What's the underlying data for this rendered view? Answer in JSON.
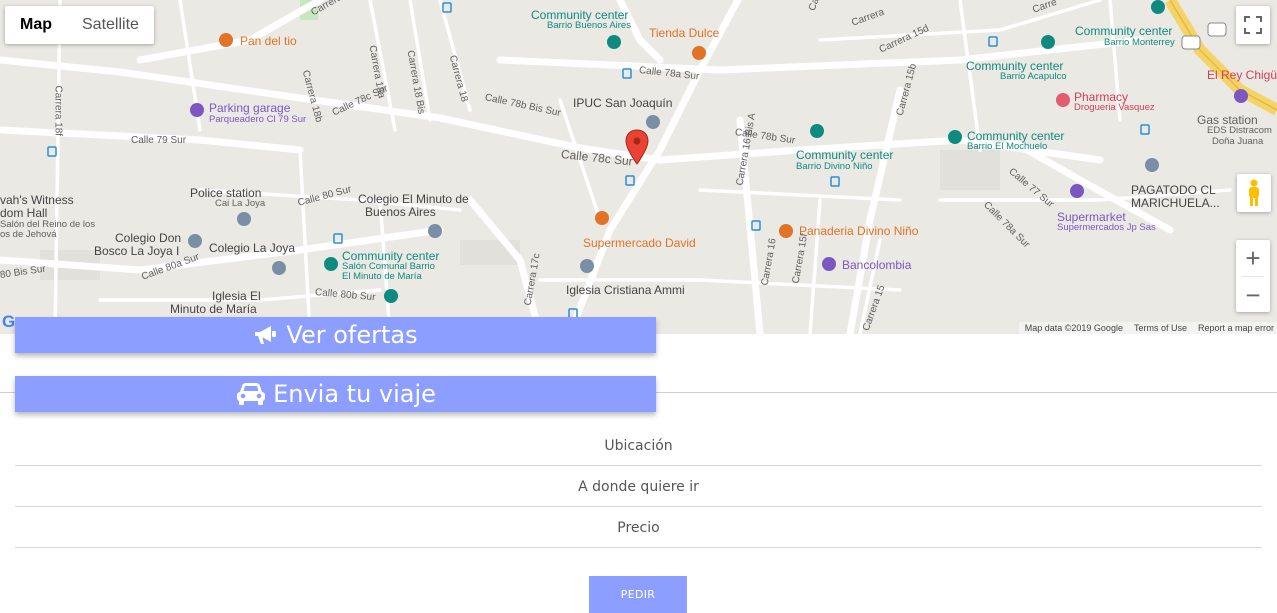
{
  "map": {
    "type_controls": {
      "map": "Map",
      "satellite": "Satellite"
    },
    "attribution": {
      "data": "Map data ©2019 Google",
      "terms": "Terms of Use",
      "report": "Report a map error"
    },
    "google_mark": "G",
    "pois": [
      {
        "name": "Pan del tio",
        "sub": ""
      },
      {
        "name": "Community center",
        "sub": "Barrio Buenos Aires"
      },
      {
        "name": "Tienda Dulce",
        "sub": ""
      },
      {
        "name": "Community center",
        "sub": "Barrio Monterrey"
      },
      {
        "name": "Parking garage",
        "sub": "Parqueadero Cl 79 Sur"
      },
      {
        "name": "IPUC San Joaquín",
        "sub": ""
      },
      {
        "name": "Community center",
        "sub": "Barrio Acapulco"
      },
      {
        "name": "El Rey Chigü",
        "sub": ""
      },
      {
        "name": "Pharmacy",
        "sub": "Drogueria Vasquez"
      },
      {
        "name": "Gas station",
        "sub": "EDS Distracom"
      },
      {
        "name": "Doña Juana",
        "sub": ""
      },
      {
        "name": "Community center",
        "sub": "Barrio El Mochuelo"
      },
      {
        "name": "Community center",
        "sub": "Barrio Divino Niño"
      },
      {
        "name": "Police station",
        "sub": "Cai La Joya"
      },
      {
        "name": "Colegio El Minuto de",
        "sub": ""
      },
      {
        "name": "Buenos Aires",
        "sub": ""
      },
      {
        "name": "PAGATODO CL",
        "sub": ""
      },
      {
        "name": "MARICHUELA...",
        "sub": ""
      },
      {
        "name": "Supermarket",
        "sub": "Supermercados Jp Sas"
      },
      {
        "name": "vah's Witness",
        "sub": ""
      },
      {
        "name": "dom Hall",
        "sub": ""
      },
      {
        "name": "Salón del Reino de los",
        "sub": "os de Jehová"
      },
      {
        "name": "Colegio Don",
        "sub": ""
      },
      {
        "name": "Bosco La Joya I",
        "sub": ""
      },
      {
        "name": "Colegio La Joya",
        "sub": ""
      },
      {
        "name": "Community center",
        "sub": "Salón Comunal Barrio"
      },
      {
        "name": "El Minuto de María",
        "sub": ""
      },
      {
        "name": "Supermercado David",
        "sub": ""
      },
      {
        "name": "Panaderia Divino Niño",
        "sub": ""
      },
      {
        "name": "Bancolombia",
        "sub": ""
      },
      {
        "name": "Iglesia Cristiana Ammi",
        "sub": ""
      },
      {
        "name": "Iglesia El",
        "sub": ""
      },
      {
        "name": "Minuto de María",
        "sub": ""
      }
    ],
    "streets": [
      "Carrera 78",
      "Calle 78 Sur",
      "Carrera 18a",
      "Carrera 18 Bis",
      "Carrera 18",
      "Calle 78a Sur",
      "Calle 78c Sur",
      "Carrera 18b",
      "Carrera 18f",
      "Calle 79 Sur",
      "Calle 78b Bis Sur",
      "Calle 78c Sur",
      "Calle 78b Sur",
      "Carrera 16 Bis A",
      "Carrera 15b",
      "Carrera 15d",
      "Calle 77 Sur",
      "Calle 78a Sur",
      "Calle 80 Sur",
      "Calle 80a Sur",
      "Calle 80b Sur",
      "Carrera 17c",
      "Carrera 16",
      "Carrera 15f",
      "Carrera 15",
      "80 Bis Sur",
      "Carre",
      "Carrera"
    ]
  },
  "actions": {
    "ofertas": "Ver ofertas",
    "viaje": "Envia tu viaje"
  },
  "form": {
    "ubicacion_placeholder": "Ubicación",
    "destino_placeholder": "A donde quiere ir",
    "precio_placeholder": "Precio",
    "submit": "PEDIR"
  },
  "colors": {
    "button": "#8c9eff",
    "poi_teal": "#0f8a80",
    "poi_orange": "#e27225",
    "poi_purple": "#7b57c2",
    "marker_red": "#ea4335"
  }
}
